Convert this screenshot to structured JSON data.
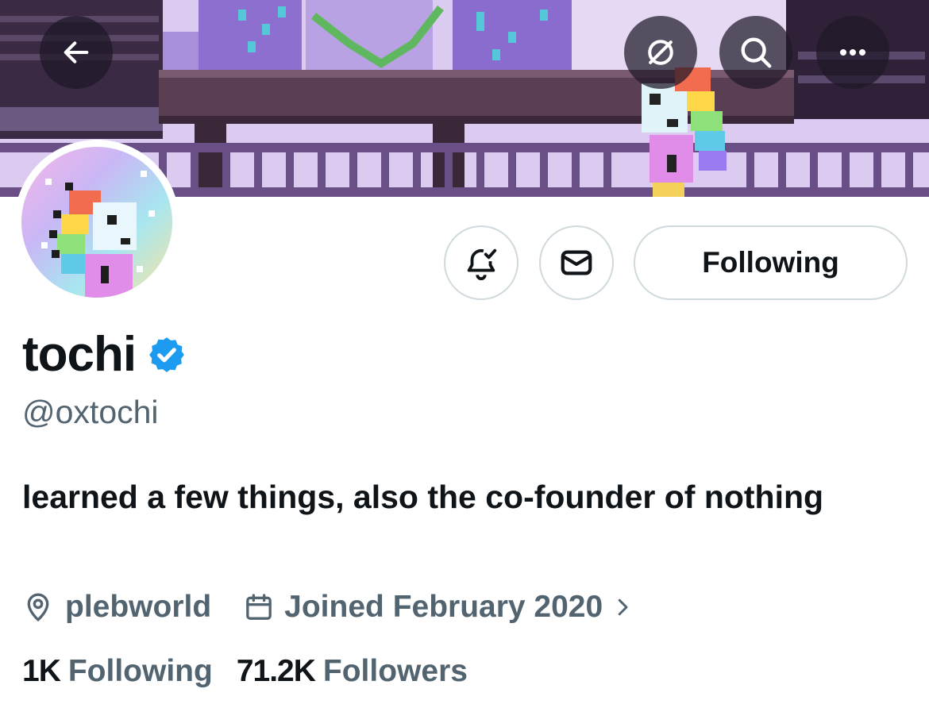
{
  "header": {
    "back_icon": "arrow-left-icon",
    "actions": [
      "grok-icon",
      "search-icon",
      "more-icon"
    ],
    "banner_description": "pixel-art city skyline with a rainbow pixel character on a bridge"
  },
  "profile": {
    "display_name": "tochi",
    "handle": "@oxtochi",
    "verified": true,
    "verified_color": "#1d9bf0",
    "bio": "learned a few things, also the co-founder of nothing",
    "location": "plebworld",
    "joined": "Joined February 2020"
  },
  "actions": {
    "notify_icon": "bell-check-icon",
    "message_icon": "envelope-icon",
    "follow_label": "Following"
  },
  "stats": {
    "following_count": "1K",
    "following_label": "Following",
    "followers_count": "71.2K",
    "followers_label": "Followers"
  },
  "colors": {
    "text_primary": "#0f1419",
    "text_secondary": "#536471",
    "border": "#cfd9de"
  }
}
